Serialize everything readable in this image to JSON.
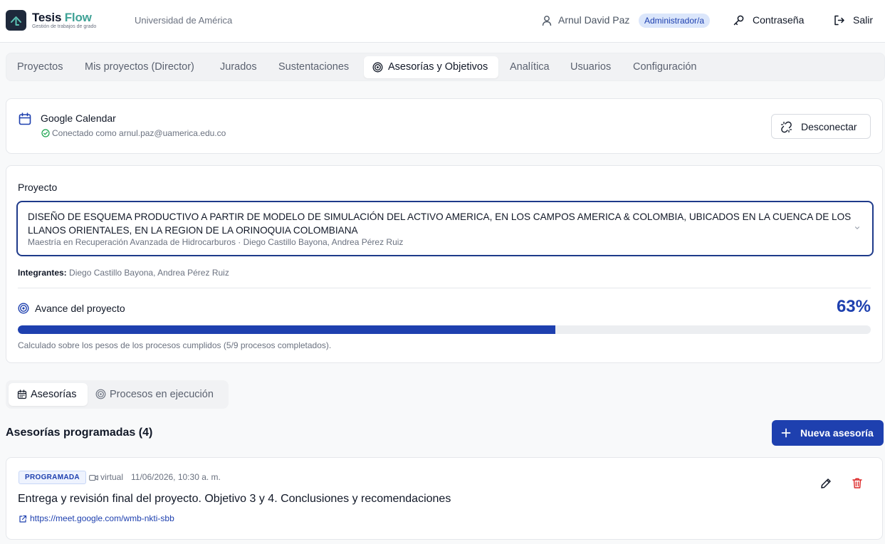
{
  "app": {
    "brand_main": "Tesis",
    "brand_accent": "Flow",
    "brand_sub": "Gestión de trabajos de grado",
    "institution": "Universidad de América"
  },
  "header": {
    "user_name": "Arnul David Paz",
    "role": "Administrador/a",
    "password_label": "Contraseña",
    "logout_label": "Salir"
  },
  "nav": {
    "tabs": [
      {
        "label": "Proyectos"
      },
      {
        "label": "Mis proyectos (Director)"
      },
      {
        "label": "Jurados"
      },
      {
        "label": "Sustentaciones"
      },
      {
        "label": "Asesorías y Objetivos",
        "active": true
      },
      {
        "label": "Analítica"
      },
      {
        "label": "Usuarios"
      },
      {
        "label": "Configuración"
      }
    ]
  },
  "calendar": {
    "title": "Google Calendar",
    "status": "Conectado como arnul.paz@uamerica.edu.co",
    "disconnect_label": "Desconectar"
  },
  "project": {
    "label": "Proyecto",
    "selected_title": "DISEÑO DE ESQUEMA PRODUCTIVO A PARTIR DE MODELO DE SIMULACIÓN DEL ACTIVO AMERICA, EN LOS CAMPOS AMERICA & COLOMBIA, UBICADOS EN LA CUENCA DE LOS LLANOS ORIENTALES, EN LA REGION DE LA ORINOQUIA COLOMBIANA",
    "selected_subtitle": "Maestría en Recuperación Avanzada de Hidrocarburos · Diego Castillo Bayona, Andrea Pérez Ruiz",
    "members_label": "Integrantes:",
    "members": "Diego Castillo Bayona, Andrea Pérez Ruiz",
    "progress_label": "Avance del proyecto",
    "progress_text": "63%",
    "progress_value": 63,
    "progress_note": "Calculado sobre los pesos de los procesos cumplidos (5/9 procesos completados)."
  },
  "subtabs": {
    "asesorias": "Asesorías",
    "procesos": "Procesos en ejecución"
  },
  "asesorias": {
    "section_title": "Asesorías programadas (4)",
    "new_label": "Nueva asesoría",
    "items": [
      {
        "status": "PROGRAMADA",
        "mode": "virtual",
        "datetime": "11/06/2026, 10:30 a. m.",
        "title": "Entrega y revisión final del proyecto. Objetivo 3 y 4. Conclusiones y recomendaciones",
        "link": "https://meet.google.com/wmb-nkti-sbb"
      }
    ]
  },
  "colors": {
    "primary": "#1e40af",
    "brand_accent": "#3fa296",
    "danger": "#dc2626",
    "success": "#16a34a"
  },
  "icons": [
    "logo-icon",
    "user-icon",
    "key-icon",
    "logout-icon",
    "target-icon",
    "calendar-icon",
    "check-circle-icon",
    "unlink-icon",
    "chevron-down-icon",
    "plus-icon",
    "video-icon",
    "external-link-icon",
    "pencil-icon",
    "trash-icon"
  ]
}
